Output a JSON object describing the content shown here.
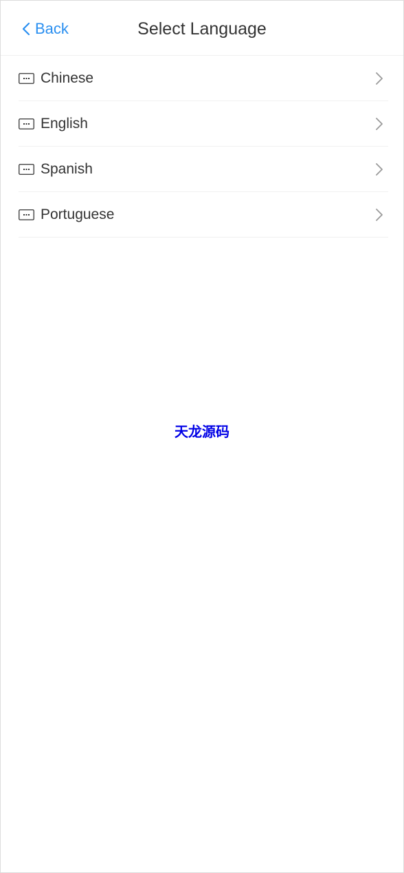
{
  "nav": {
    "back_label": "Back",
    "title": "Select Language"
  },
  "languages": [
    {
      "label": "Chinese",
      "icon": "keyboard-icon"
    },
    {
      "label": "English",
      "icon": "keyboard-icon"
    },
    {
      "label": "Spanish",
      "icon": "keyboard-icon"
    },
    {
      "label": "Portuguese",
      "icon": "keyboard-icon"
    }
  ],
  "watermark": "天龙源码",
  "colors": {
    "accent": "#2a8ff0",
    "text": "#333333",
    "watermark": "#0000e6"
  }
}
